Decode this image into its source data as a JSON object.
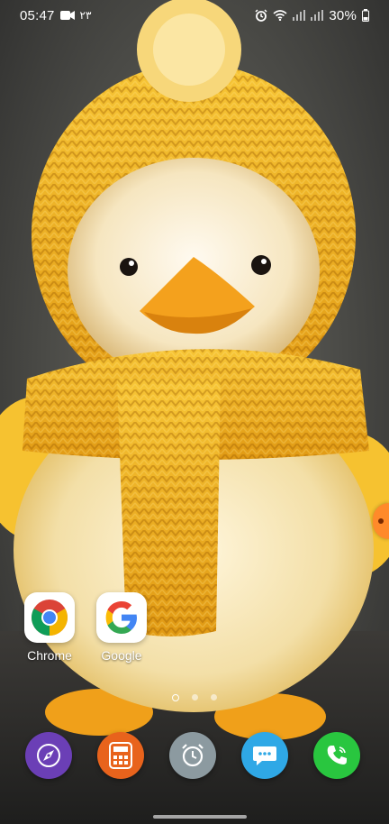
{
  "status_bar": {
    "time": "05:47",
    "notif_text": "٢٣",
    "battery": "30%",
    "icons": [
      "video-camera-icon",
      "alarm-icon",
      "wifi-icon",
      "signal-icon",
      "signal-icon",
      "battery-icon"
    ]
  },
  "home": {
    "apps": [
      {
        "label": "Chrome",
        "icon": "chrome-icon"
      },
      {
        "label": "Google",
        "icon": "google-icon"
      }
    ],
    "pages": {
      "count": 3,
      "current": 1
    }
  },
  "dock": {
    "apps": [
      {
        "icon": "internet-browser-icon",
        "color": "#6b3fb6"
      },
      {
        "icon": "calculator-icon",
        "color": "#e8631c"
      },
      {
        "icon": "clock-icon",
        "color": "#8c9aa0"
      },
      {
        "icon": "messages-icon",
        "color": "#2fa8e6"
      },
      {
        "icon": "phone-icon",
        "color": "#29c63f"
      }
    ]
  },
  "colors": {
    "accent_yellow": "#f3b31c",
    "edge_handle": "#ff8a2a"
  }
}
